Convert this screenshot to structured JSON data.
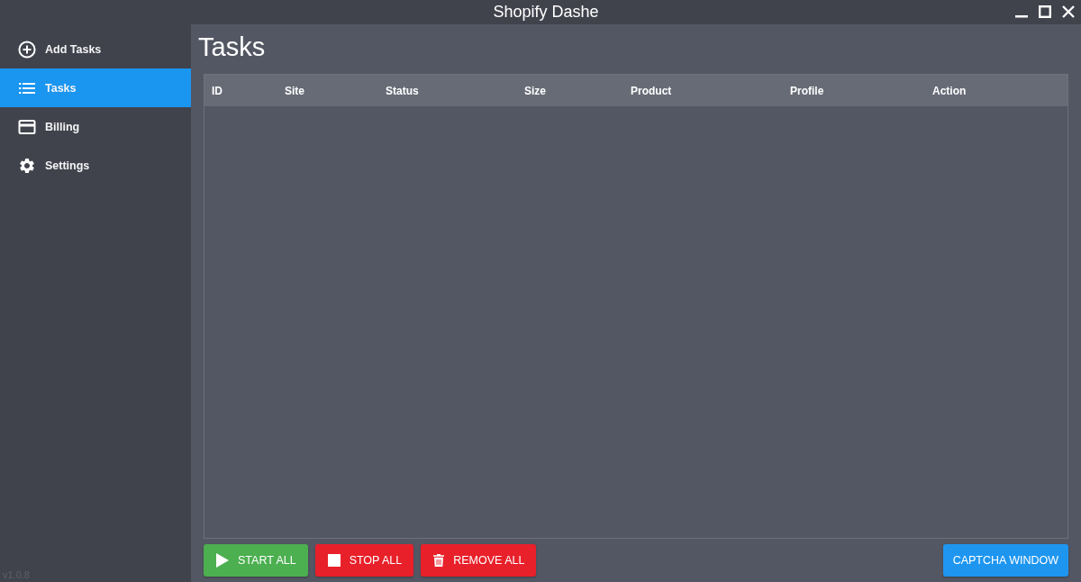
{
  "window": {
    "title": "Shopify Dashe"
  },
  "sidebar": {
    "items": [
      {
        "label": "Add Tasks",
        "selected": false
      },
      {
        "label": "Tasks",
        "selected": true
      },
      {
        "label": "Billing",
        "selected": false
      },
      {
        "label": "Settings",
        "selected": false
      }
    ],
    "version": "v1.0.8"
  },
  "page": {
    "heading": "Tasks"
  },
  "table": {
    "columns": [
      "ID",
      "Site",
      "Status",
      "Size",
      "Product",
      "Profile",
      "Action"
    ]
  },
  "actions": [
    {
      "label": "START ALL",
      "color": "#4caf50"
    },
    {
      "label": "STOP ALL",
      "color": "#e8202a"
    },
    {
      "label": "REMOVE ALL",
      "color": "#e8202a"
    }
  ],
  "captcha_button": {
    "label": "CAPTCHA WINDOW",
    "color": "#1e96f0"
  }
}
